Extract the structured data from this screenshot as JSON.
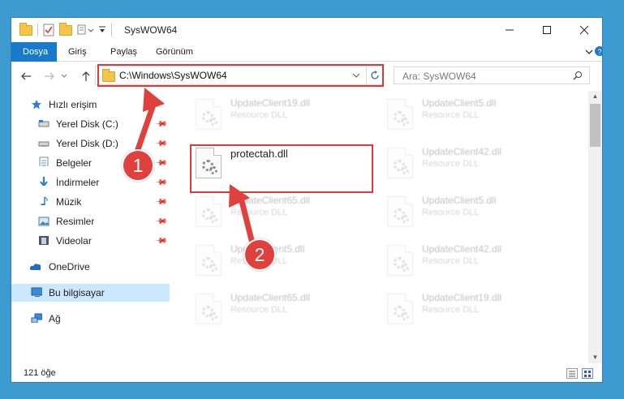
{
  "window": {
    "title": "SysWOW64",
    "controls": [
      "minimize-icon",
      "maximize-icon",
      "close-icon"
    ]
  },
  "ribbon": {
    "tabs": [
      {
        "label": "Dosya",
        "active": true
      },
      {
        "label": "Giriş",
        "active": false
      },
      {
        "label": "Paylaş",
        "active": false
      },
      {
        "label": "Görünüm",
        "active": false
      }
    ]
  },
  "address": {
    "path": "C:\\Windows\\SysWOW64",
    "search_placeholder": "Ara: SysWOW64"
  },
  "sidebar": {
    "items": [
      {
        "label": "Hızlı erişim",
        "icon": "star-icon",
        "pinned": false
      },
      {
        "label": "Yerel Disk (C:)",
        "icon": "drive-icon",
        "pinned": true
      },
      {
        "label": "Yerel Disk (D:)",
        "icon": "drive-icon",
        "pinned": true
      },
      {
        "label": "Belgeler",
        "icon": "documents-icon",
        "pinned": true
      },
      {
        "label": "İndirmeler",
        "icon": "download-arrow-icon",
        "pinned": true
      },
      {
        "label": "Müzik",
        "icon": "music-note-icon",
        "pinned": true
      },
      {
        "label": "Resimler",
        "icon": "pictures-icon",
        "pinned": true
      },
      {
        "label": "Videolar",
        "icon": "film-icon",
        "pinned": true
      },
      {
        "label": "OneDrive",
        "icon": "cloud-icon",
        "pinned": false
      },
      {
        "label": "Bu bilgisayar",
        "icon": "computer-icon",
        "pinned": false,
        "selected": true
      },
      {
        "label": "Ağ",
        "icon": "network-icon",
        "pinned": false
      }
    ]
  },
  "files": [
    {
      "name": "UpdateClient19.dll",
      "type": "Resource DLL",
      "faded": true
    },
    {
      "name": "UpdateClient5.dll",
      "type": "Resource DLL",
      "faded": true
    },
    {
      "name": "protectah.dll",
      "type": "",
      "faded": false
    },
    {
      "name": "UpdateClient42.dll",
      "type": "Resource DLL",
      "faded": true
    },
    {
      "name": "UpdateClient65.dll",
      "type": "Resource DLL",
      "faded": true
    },
    {
      "name": "UpdateClient5.dll",
      "type": "Resource DLL",
      "faded": true
    },
    {
      "name": "UpdateClient5.dll",
      "type": "Resource DLL",
      "faded": true
    },
    {
      "name": "UpdateClient42.dll",
      "type": "Resource DLL",
      "faded": true
    },
    {
      "name": "UpdateClient65.dll",
      "type": "Resource DLL",
      "faded": true
    },
    {
      "name": "UpdateClient19.dll",
      "type": "Resource DLL",
      "faded": true
    }
  ],
  "status": {
    "count": "121 öğe"
  },
  "annotations": {
    "step1": "1",
    "step2": "2",
    "color": "#e1413d"
  }
}
